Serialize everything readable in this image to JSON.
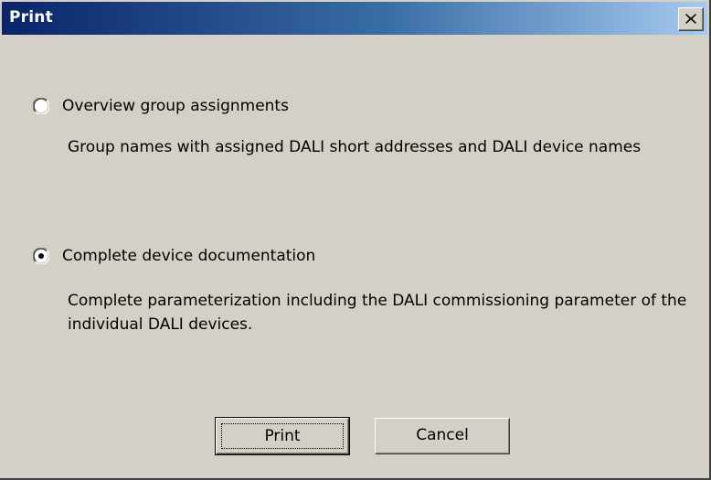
{
  "window": {
    "title": "Print",
    "close_icon": "close-icon"
  },
  "options": [
    {
      "label": "Overview group assignments",
      "description": "Group names with assigned DALI short addresses and DALI device names",
      "selected": false
    },
    {
      "label": "Complete device documentation",
      "description": "Complete parameterization including the DALI commissioning parameter of the individual DALI devices.",
      "selected": true
    }
  ],
  "buttons": {
    "print_label": "Print",
    "cancel_label": "Cancel"
  }
}
